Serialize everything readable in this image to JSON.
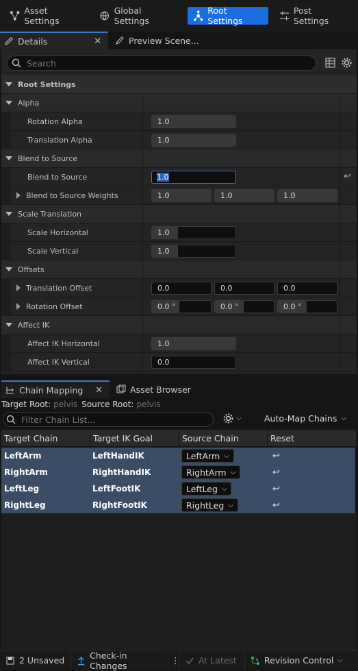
{
  "toolbar": {
    "asset_settings": "Asset Settings",
    "global_settings": "Global Settings",
    "root_settings": "Root Settings",
    "post_settings": "Post Settings"
  },
  "details_tabs": {
    "details": "Details",
    "preview_scene": "Preview Scene..."
  },
  "search": {
    "placeholder": "Search"
  },
  "category": "Root Settings",
  "groups": {
    "alpha": "Alpha",
    "blend_to_source": "Blend to Source",
    "scale_translation": "Scale Translation",
    "offsets": "Offsets",
    "affect_ik": "Affect IK"
  },
  "props": {
    "rotation_alpha": {
      "label": "Rotation Alpha",
      "value": "1.0",
      "fill": 1.0
    },
    "translation_alpha": {
      "label": "Translation Alpha",
      "value": "1.0",
      "fill": 1.0
    },
    "blend_to_source": {
      "label": "Blend to Source",
      "value": "1.0"
    },
    "blend_to_source_weights": {
      "label": "Blend to Source Weights",
      "x": "1.0",
      "y": "1.0",
      "z": "1.0"
    },
    "scale_horizontal": {
      "label": "Scale Horizontal",
      "value": "1.0"
    },
    "scale_vertical": {
      "label": "Scale Vertical",
      "value": "1.0"
    },
    "translation_offset": {
      "label": "Translation Offset",
      "x": "0.0",
      "y": "0.0",
      "z": "0.0"
    },
    "rotation_offset": {
      "label": "Rotation Offset",
      "x": "0.0 °",
      "y": "0.0 °",
      "z": "0.0 °"
    },
    "affect_ik_horizontal": {
      "label": "Affect IK Horizontal",
      "value": "1.0"
    },
    "affect_ik_vertical": {
      "label": "Affect IK Vertical",
      "value": "0.0"
    }
  },
  "chain_mapping": {
    "tab": "Chain Mapping",
    "asset_browser_tab": "Asset Browser",
    "target_root_label": "Target Root:",
    "target_root_value": "pelvis",
    "source_root_label": "Source Root:",
    "source_root_value": "pelvis",
    "filter_placeholder": "Filter Chain List...",
    "auto_map": "Auto-Map Chains",
    "columns": [
      "Target Chain",
      "Target IK Goal",
      "Source Chain",
      "Reset"
    ],
    "rows": [
      {
        "target": "LeftArm",
        "goal": "LeftHandIK",
        "source": "LeftArm"
      },
      {
        "target": "RightArm",
        "goal": "RightHandIK",
        "source": "RightArm"
      },
      {
        "target": "LeftLeg",
        "goal": "LeftFootIK",
        "source": "LeftLeg"
      },
      {
        "target": "RightLeg",
        "goal": "RightFootIK",
        "source": "RightLeg"
      }
    ]
  },
  "status": {
    "unsaved": "2 Unsaved",
    "check_in": "Check-in Changes",
    "at_latest": "At Latest",
    "revision_control": "Revision Control"
  }
}
